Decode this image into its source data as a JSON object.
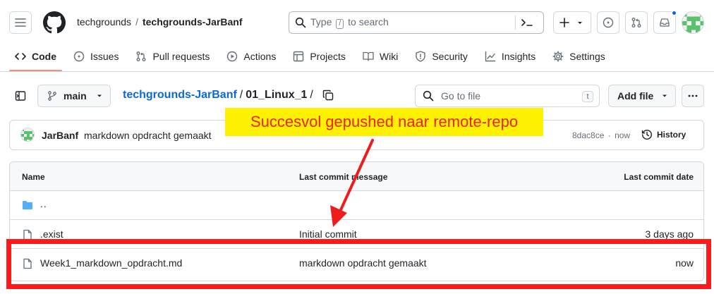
{
  "header": {
    "org": "techgrounds",
    "separator": "/",
    "repo": "techgrounds-JarBanf",
    "search_before": "Type",
    "search_key": "/",
    "search_after": "to search"
  },
  "nav": {
    "items": [
      {
        "label": "Code",
        "icon": "code-icon"
      },
      {
        "label": "Issues",
        "icon": "issue-icon"
      },
      {
        "label": "Pull requests",
        "icon": "pull-request-icon"
      },
      {
        "label": "Actions",
        "icon": "play-icon"
      },
      {
        "label": "Projects",
        "icon": "table-icon"
      },
      {
        "label": "Wiki",
        "icon": "book-icon"
      },
      {
        "label": "Security",
        "icon": "shield-icon"
      },
      {
        "label": "Insights",
        "icon": "graph-icon"
      },
      {
        "label": "Settings",
        "icon": "gear-icon"
      }
    ]
  },
  "toolbar": {
    "branch": "main",
    "repo_link": "techgrounds-JarBanf",
    "path_sep": "/",
    "folder": "01_Linux_1",
    "trailing_sep": "/",
    "goto_placeholder": "Go to file",
    "goto_key": "t",
    "add_file": "Add file"
  },
  "commit": {
    "author": "JarBanf",
    "message": "markdown opdracht gemaakt",
    "sha": "8dac8ce",
    "dot": "·",
    "time": "now",
    "history": "History"
  },
  "table": {
    "headers": {
      "name": "Name",
      "message": "Last commit message",
      "date": "Last commit date"
    },
    "parent": "..",
    "rows": [
      {
        "name": ".exist",
        "message": "Initial commit",
        "date": "3 days ago"
      },
      {
        "name": "Week1_markdown_opdracht.md",
        "message": "markdown opdracht gemaakt",
        "date": "now"
      }
    ]
  },
  "annotation": {
    "text": "Succesvol gepushed naar remote-repo",
    "colors": {
      "box": "#fff200",
      "text": "#ee2222",
      "highlight": "#fe1a1a"
    }
  },
  "colors": {
    "accent": "#0969da",
    "nav_underline": "#fd8c73",
    "folder": "#54aeff",
    "border": "#d0d7de"
  }
}
